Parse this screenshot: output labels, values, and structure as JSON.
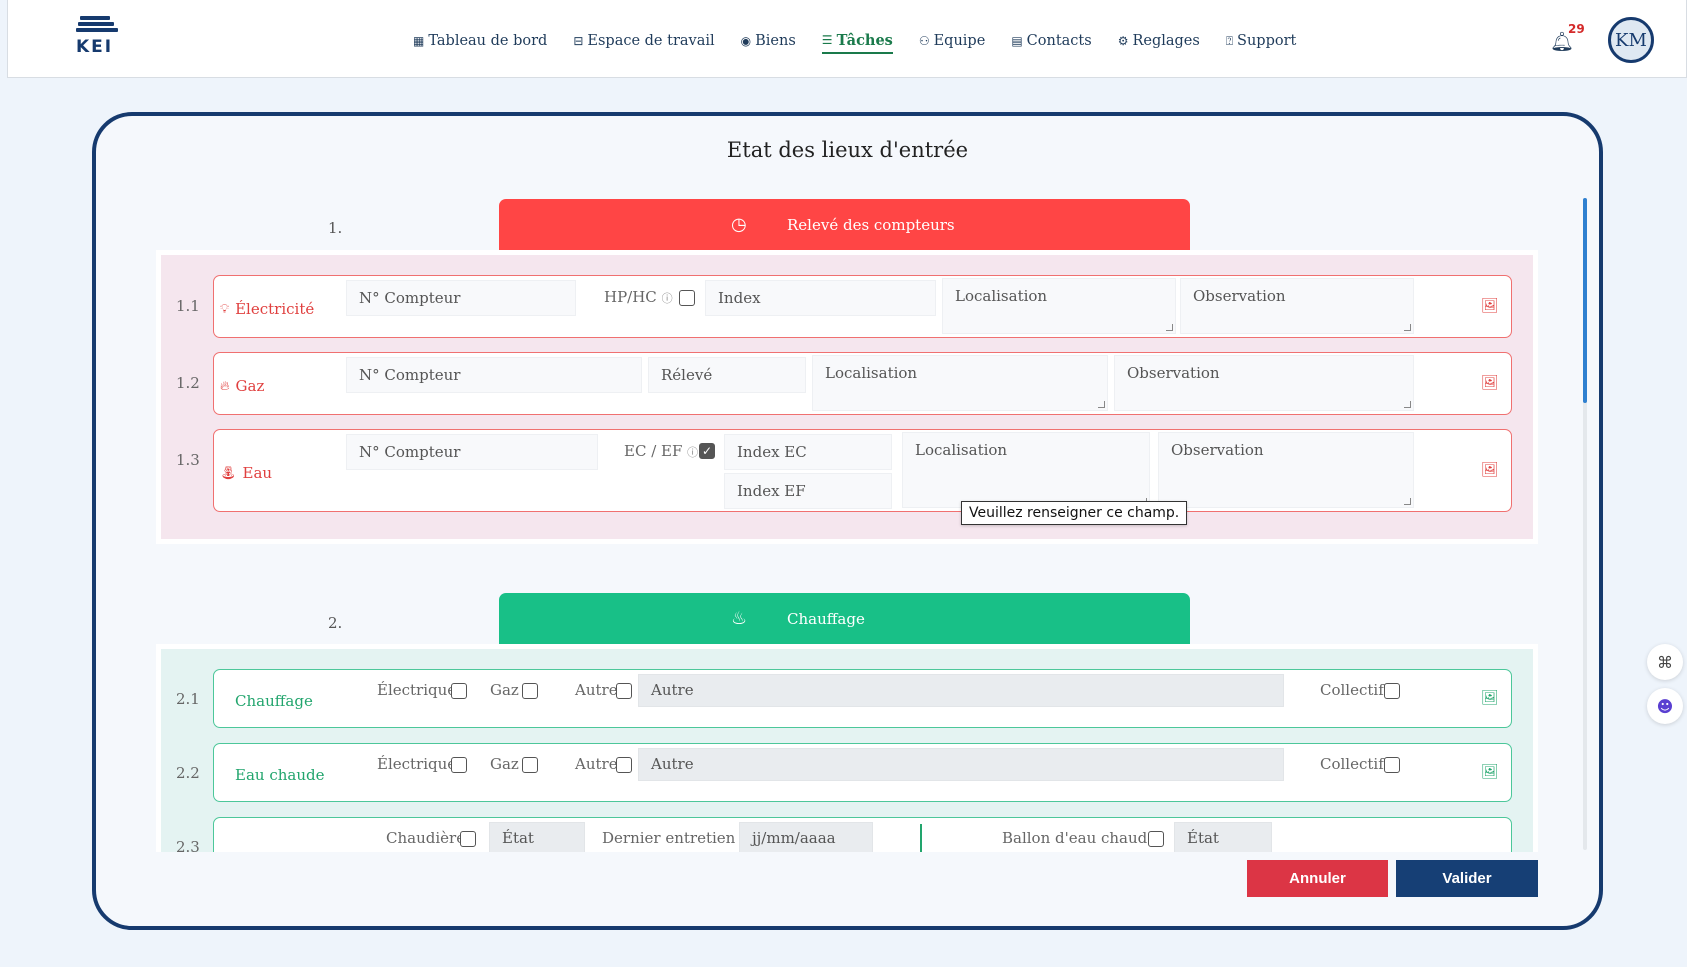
{
  "brand": {
    "logo_text": "KEI"
  },
  "nav": [
    {
      "icon": "▦",
      "label": "Tableau de bord"
    },
    {
      "icon": "⊟",
      "label": "Espace de travail"
    },
    {
      "icon": "◉",
      "label": "Biens"
    },
    {
      "icon": "☰",
      "label": "Tâches"
    },
    {
      "icon": "⚇",
      "label": "Equipe"
    },
    {
      "icon": "▤",
      "label": "Contacts"
    },
    {
      "icon": "⚙",
      "label": "Reglages"
    },
    {
      "icon": "⍰",
      "label": "Support"
    }
  ],
  "notifications": {
    "count": "29"
  },
  "user": {
    "initials": "KM"
  },
  "modal": {
    "title": "Etat des lieux d'entrée",
    "section1": {
      "number": "1.",
      "title": "Relevé des compteurs",
      "rows": {
        "electricite": {
          "num": "1.1",
          "label": "Électricité",
          "compteur_ph": "N° Compteur",
          "hphc_label": "HP/HC",
          "index_ph": "Index",
          "loc_ph": "Localisation",
          "obs_ph": "Observation"
        },
        "gaz": {
          "num": "1.2",
          "label": "Gaz",
          "compteur_ph": "N° Compteur",
          "releve_ph": "Rélevé",
          "loc_ph": "Localisation",
          "obs_ph": "Observation"
        },
        "eau": {
          "num": "1.3",
          "label": "Eau",
          "compteur_ph": "N° Compteur",
          "ecef_label": "EC / EF",
          "index_ec_ph": "Index EC",
          "index_ef_ph": "Index EF",
          "loc_ph": "Localisation",
          "obs_ph": "Observation"
        }
      },
      "tooltip": "Veuillez renseigner ce champ."
    },
    "section2": {
      "number": "2.",
      "title": "Chauffage",
      "rows": {
        "chauffage": {
          "num": "2.1",
          "label": "Chauffage",
          "opt_elec": "Électrique",
          "opt_gaz": "Gaz",
          "opt_autre": "Autre",
          "autre_ph": "Autre",
          "collectif": "Collectif"
        },
        "eau_chaude": {
          "num": "2.2",
          "label": "Eau chaude",
          "opt_elec": "Électrique",
          "opt_gaz": "Gaz",
          "opt_autre": "Autre",
          "autre_ph": "Autre",
          "collectif": "Collectif"
        },
        "chaudiere": {
          "num": "2.3",
          "chaudiere": "Chaudière",
          "etat_ph": "État",
          "dernier_entretien": "Dernier entretien",
          "date_ph": "jj/mm/aaaa",
          "ballon": "Ballon d'eau chaude",
          "etat2_ph": "État"
        }
      }
    },
    "buttons": {
      "cancel": "Annuler",
      "ok": "Valider"
    }
  },
  "colors": {
    "red": "#ff4545",
    "green": "#18c087",
    "navy": "#163a6e"
  }
}
